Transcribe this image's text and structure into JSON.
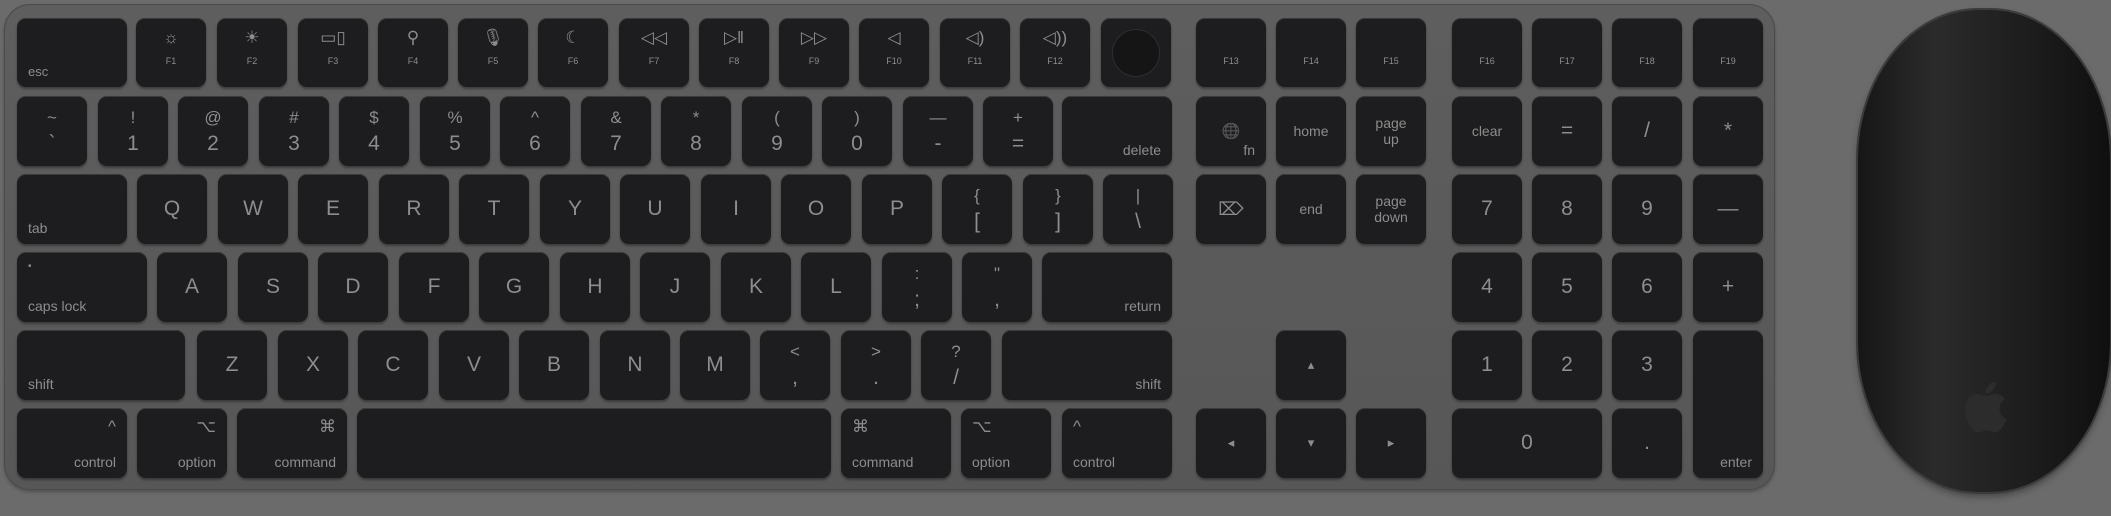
{
  "function_row": [
    {
      "label": "esc",
      "icon": ""
    },
    {
      "label": "F1",
      "icon": "☼"
    },
    {
      "label": "F2",
      "icon": "☀"
    },
    {
      "label": "F3",
      "icon": "▭▯"
    },
    {
      "label": "F4",
      "icon": "⚲"
    },
    {
      "label": "F5",
      "icon": "🎙"
    },
    {
      "label": "F6",
      "icon": "☾"
    },
    {
      "label": "F7",
      "icon": "◁◁"
    },
    {
      "label": "F8",
      "icon": "▷‖"
    },
    {
      "label": "F9",
      "icon": "▷▷"
    },
    {
      "label": "F10",
      "icon": "◁"
    },
    {
      "label": "F11",
      "icon": "◁)"
    },
    {
      "label": "F12",
      "icon": "◁))"
    },
    {
      "label": "F13",
      "icon": ""
    },
    {
      "label": "F14",
      "icon": ""
    },
    {
      "label": "F15",
      "icon": ""
    },
    {
      "label": "F16",
      "icon": ""
    },
    {
      "label": "F17",
      "icon": ""
    },
    {
      "label": "F18",
      "icon": ""
    },
    {
      "label": "F19",
      "icon": ""
    }
  ],
  "number_row": [
    {
      "top": "~",
      "bottom": "`"
    },
    {
      "top": "!",
      "bottom": "1"
    },
    {
      "top": "@",
      "bottom": "2"
    },
    {
      "top": "#",
      "bottom": "3"
    },
    {
      "top": "$",
      "bottom": "4"
    },
    {
      "top": "%",
      "bottom": "5"
    },
    {
      "top": "^",
      "bottom": "6"
    },
    {
      "top": "&",
      "bottom": "7"
    },
    {
      "top": "*",
      "bottom": "8"
    },
    {
      "top": "(",
      "bottom": "9"
    },
    {
      "top": ")",
      "bottom": "0"
    },
    {
      "top": "—",
      "bottom": "-"
    },
    {
      "top": "+",
      "bottom": "="
    }
  ],
  "delete_label": "delete",
  "tab_label": "tab",
  "qwerty_row": [
    "Q",
    "W",
    "E",
    "R",
    "T",
    "Y",
    "U",
    "I",
    "O",
    "P"
  ],
  "bracket_keys": [
    {
      "top": "{",
      "bottom": "["
    },
    {
      "top": "}",
      "bottom": "]"
    },
    {
      "top": "|",
      "bottom": "\\"
    }
  ],
  "caps_label": "caps lock",
  "caps_dot": "•",
  "asdf_row": [
    "A",
    "S",
    "D",
    "F",
    "G",
    "H",
    "J",
    "K",
    "L"
  ],
  "colon_key": {
    "top": ":",
    "bottom": ";"
  },
  "quote_key": {
    "top": "\"",
    "bottom": ","
  },
  "return_label": "return",
  "shift_label": "shift",
  "zxcv_row": [
    "Z",
    "X",
    "C",
    "V",
    "B",
    "N",
    "M"
  ],
  "punct_keys": [
    {
      "top": "<",
      "bottom": ","
    },
    {
      "top": ">",
      "bottom": "."
    },
    {
      "top": "?",
      "bottom": "/"
    }
  ],
  "bottom_row": {
    "control": "control",
    "control_symbol": "^",
    "option": "option",
    "option_symbol": "⌥",
    "command": "command",
    "command_symbol": "⌘"
  },
  "nav_cluster": {
    "fn_label": "fn",
    "globe": "🌐",
    "home": "home",
    "page_up": [
      "page",
      "up"
    ],
    "forward_delete": "⌦",
    "end": "end",
    "page_down": [
      "page",
      "down"
    ]
  },
  "arrows": {
    "up": "▴",
    "left": "◂",
    "down": "▾",
    "right": "▸"
  },
  "numpad": {
    "row1": [
      "clear",
      "=",
      "/",
      "*"
    ],
    "row2": [
      "7",
      "8",
      "9",
      "—"
    ],
    "row3": [
      "4",
      "5",
      "6",
      "+"
    ],
    "row4": [
      "1",
      "2",
      "3"
    ],
    "zero": "0",
    "dot": ".",
    "enter": "enter"
  },
  "colors": {
    "background": "#6b6b6b",
    "keyboard": "#5a5a5a",
    "key": "#1d1d1f",
    "legend": "#8d8d8d"
  }
}
